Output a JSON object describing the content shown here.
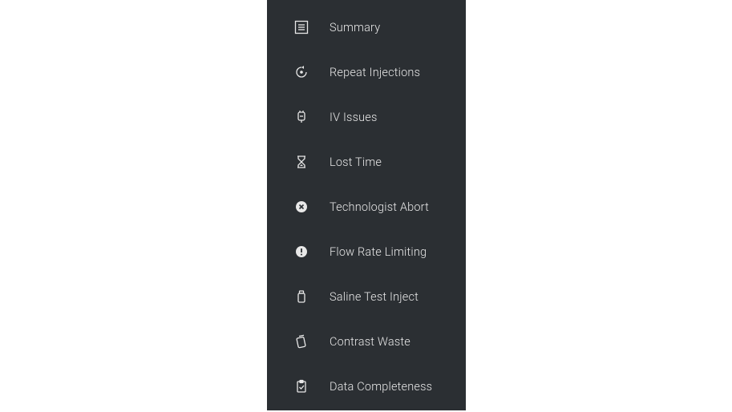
{
  "sidebar": {
    "items": [
      {
        "label": "Summary"
      },
      {
        "label": "Repeat Injections"
      },
      {
        "label": "IV Issues"
      },
      {
        "label": "Lost Time"
      },
      {
        "label": "Technologist Abort"
      },
      {
        "label": "Flow Rate Limiting"
      },
      {
        "label": "Saline Test Inject"
      },
      {
        "label": "Contrast Waste"
      },
      {
        "label": "Data Completeness"
      }
    ]
  }
}
